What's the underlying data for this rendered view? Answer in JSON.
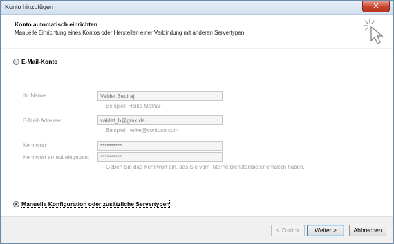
{
  "window": {
    "title": "Konto hinzufügen",
    "close_symbol": "✕"
  },
  "header": {
    "title": "Konto automatisch einrichten",
    "subtitle": "Manuelle Einrichtung eines Kontos oder Herstellen einer Verbindung mit anderen Servertypen."
  },
  "options": {
    "email_account": {
      "label": "E-Mail-Konto",
      "selected": false
    },
    "manual_config": {
      "label": "Manuelle Konfiguration oder zusätzliche Servertypen",
      "selected": true
    }
  },
  "form": {
    "name": {
      "label": "Ihr Name:",
      "value": "Valdet Beqiraj",
      "hint": "Beispiel: Heike Molnar"
    },
    "email": {
      "label": "E-Mail-Adresse:",
      "value": "valdet_b@gmx.de",
      "hint": "Beispiel: heike@contoso.com"
    },
    "password": {
      "label": "Kennwort:",
      "value": "**********"
    },
    "password_confirm": {
      "label": "Kennwort erneut eingeben:",
      "value": "**********"
    },
    "password_hint": "Geben Sie das Kennwort ein, das Sie vom Internetdienstanbieter erhalten haben."
  },
  "buttons": {
    "back": "< Zurück",
    "next": "Weiter >",
    "cancel": "Abbrechen"
  }
}
